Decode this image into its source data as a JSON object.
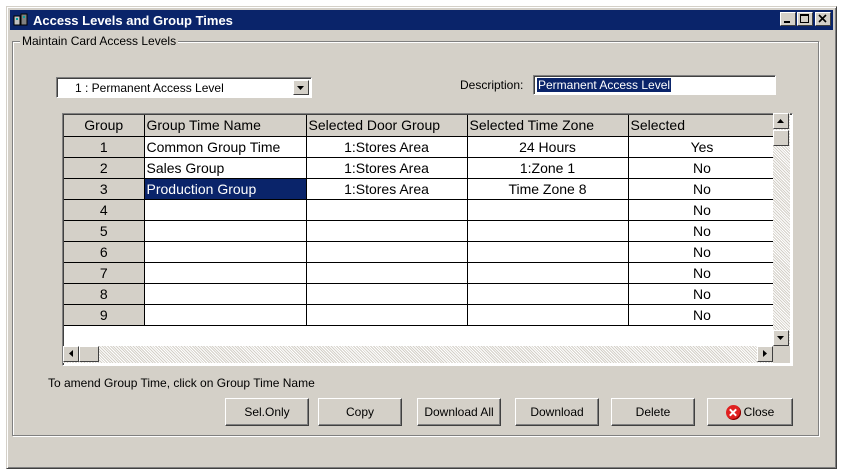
{
  "window": {
    "title": "Access Levels and Group Times",
    "icon": "app-icon"
  },
  "group": {
    "legend": "Maintain Card Access Levels"
  },
  "access_level_select": {
    "value": "1 : Permanent Access Level"
  },
  "description": {
    "label": "Description:",
    "value": "Permanent Access Level"
  },
  "grid": {
    "columns": [
      "Group",
      "Group Time Name",
      "Selected Door Group",
      "Selected Time Zone",
      "Selected"
    ],
    "rows": [
      {
        "group": "1",
        "name": "Common Group Time",
        "door_group": "1:Stores Area",
        "time_zone": "24 Hours",
        "selected": "Yes"
      },
      {
        "group": "2",
        "name": "Sales Group",
        "door_group": "1:Stores Area",
        "time_zone": "1:Zone 1",
        "selected": "No"
      },
      {
        "group": "3",
        "name": "Production Group",
        "door_group": "1:Stores Area",
        "time_zone": "Time Zone  8",
        "selected": "No"
      },
      {
        "group": "4",
        "name": "",
        "door_group": "",
        "time_zone": "",
        "selected": "No"
      },
      {
        "group": "5",
        "name": "",
        "door_group": "",
        "time_zone": "",
        "selected": "No"
      },
      {
        "group": "6",
        "name": "",
        "door_group": "",
        "time_zone": "",
        "selected": "No"
      },
      {
        "group": "7",
        "name": "",
        "door_group": "",
        "time_zone": "",
        "selected": "No"
      },
      {
        "group": "8",
        "name": "",
        "door_group": "",
        "time_zone": "",
        "selected": "No"
      },
      {
        "group": "9",
        "name": "",
        "door_group": "",
        "time_zone": "",
        "selected": "No"
      }
    ],
    "selected_row": 2
  },
  "hint": "To amend Group Time, click on Group Time Name",
  "buttons": {
    "sel_only": "Sel.Only",
    "copy": "Copy",
    "download_all": "Download All",
    "download": "Download",
    "delete": "Delete",
    "close": "Close"
  },
  "colors": {
    "title_bar": "#0a246a",
    "face": "#d4d0c8",
    "selection": "#0a246a",
    "close_icon": "#e02020"
  }
}
